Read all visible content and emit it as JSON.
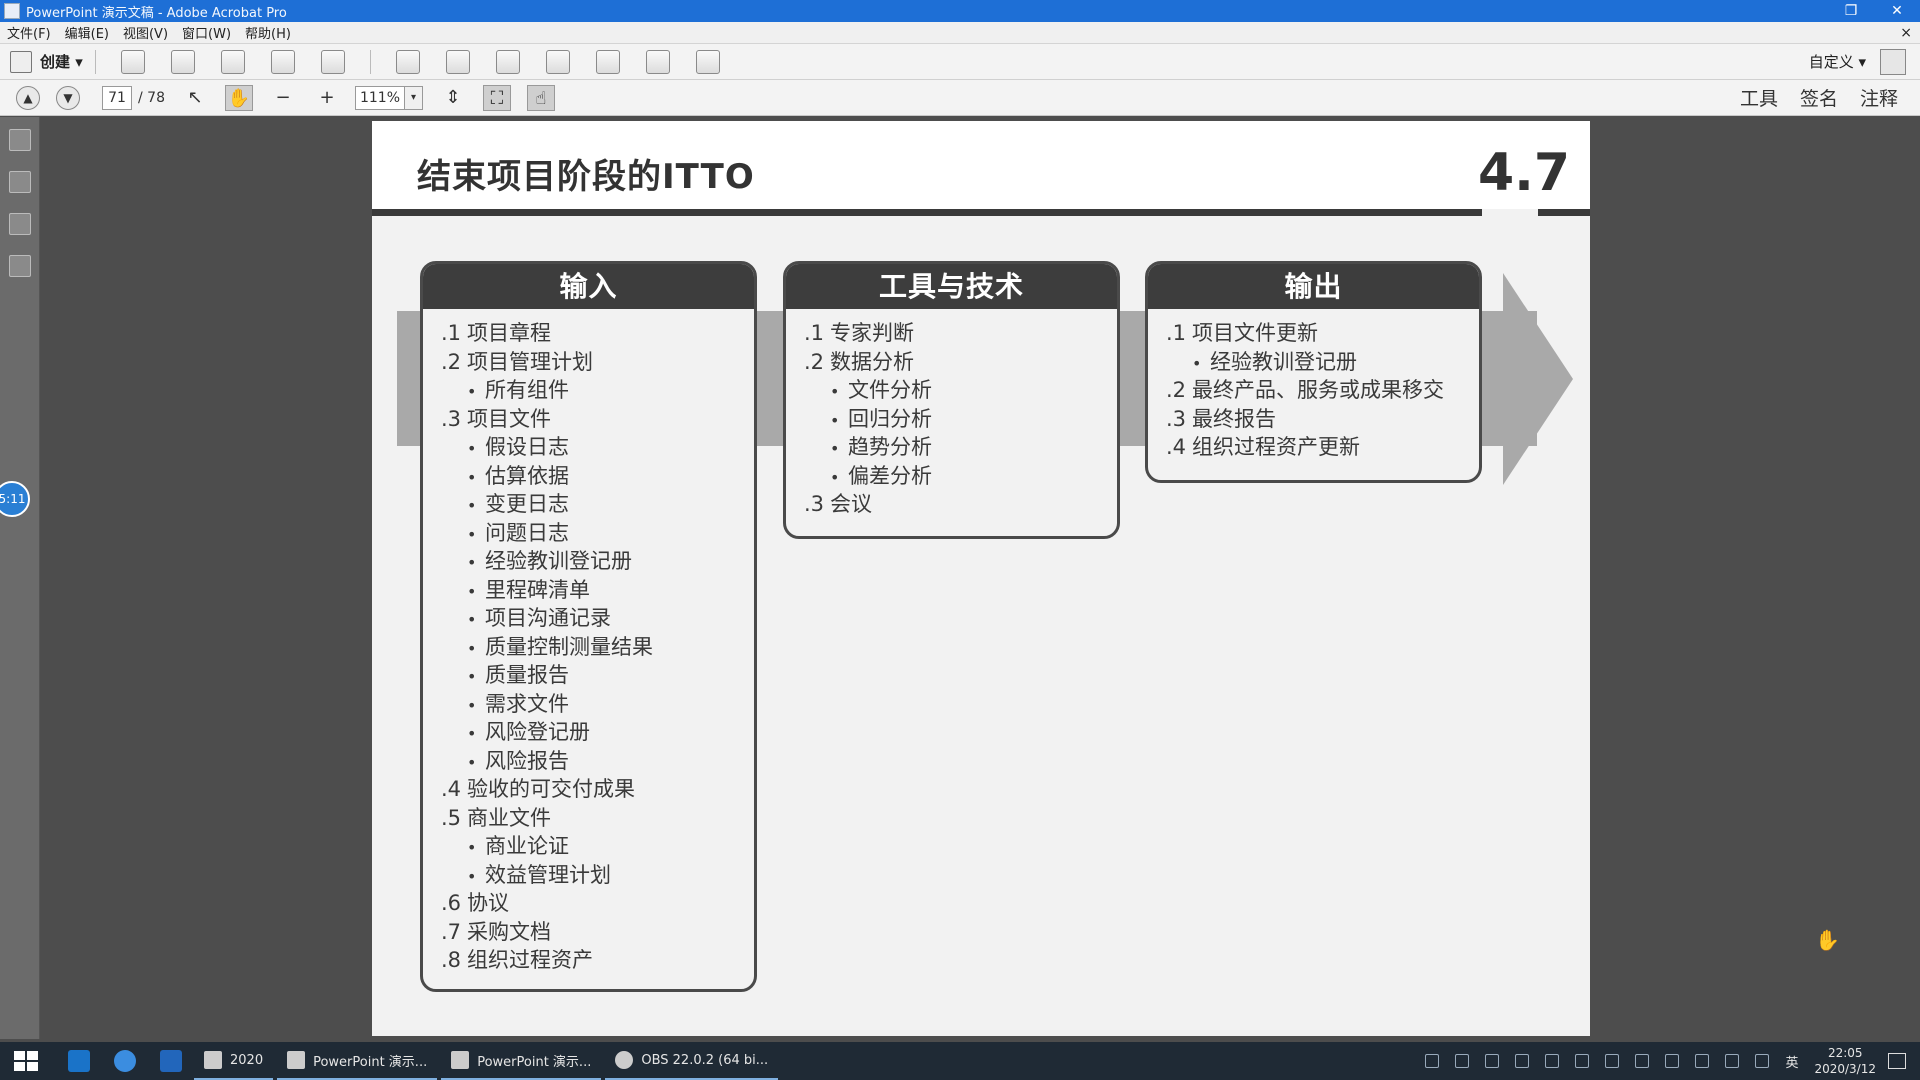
{
  "window": {
    "title": "PowerPoint 演示文稿 - Adobe Acrobat Pro",
    "restore_glyph": "❐",
    "close_glyph": "✕"
  },
  "menu": [
    "文件(F)",
    "编辑(E)",
    "视图(V)",
    "窗口(W)",
    "帮助(H)"
  ],
  "menu_close": "×",
  "toolbar": {
    "create_label": "创建 ▾",
    "customize_label": "自定义 ▾",
    "icons": [
      "open-icon",
      "save-icon",
      "print-icon",
      "edit-icon",
      "email-icon",
      "settings-icon",
      "comment-icon",
      "stamp-icon",
      "export-icon",
      "combine-icon",
      "protect-icon",
      "share-icon"
    ]
  },
  "nav": {
    "prev_glyph": "▲",
    "next_glyph": "▼",
    "current_page": "71",
    "total_pages": "/ 78",
    "select_glyph": "↖",
    "hand_glyph": "✋",
    "zoom_out_glyph": "−",
    "zoom_in_glyph": "+",
    "zoom": "111%",
    "zoom_drop_glyph": "▾",
    "fit_glyph": "⇕",
    "fullscreen_glyph": "⛶",
    "touch_glyph": "☝",
    "tools": "工具",
    "sign": "签名",
    "comment": "注释"
  },
  "timer": "5:11",
  "slide": {
    "title": "结束项目阶段的ITTO",
    "number": "4.7",
    "inputs": {
      "heading": "输入",
      "items": [
        {
          "n": ".1",
          "t": "项目章程"
        },
        {
          "n": ".2",
          "t": "项目管理计划"
        },
        {
          "sub": "所有组件"
        },
        {
          "n": ".3",
          "t": "项目文件"
        },
        {
          "sub": "假设日志"
        },
        {
          "sub": "估算依据"
        },
        {
          "sub": "变更日志"
        },
        {
          "sub": "问题日志"
        },
        {
          "sub": "经验教训登记册"
        },
        {
          "sub": "里程碑清单"
        },
        {
          "sub": "项目沟通记录"
        },
        {
          "sub": "质量控制测量结果"
        },
        {
          "sub": "质量报告"
        },
        {
          "sub": "需求文件"
        },
        {
          "sub": "风险登记册"
        },
        {
          "sub": "风险报告"
        },
        {
          "n": ".4",
          "t": "验收的可交付成果"
        },
        {
          "n": ".5",
          "t": "商业文件"
        },
        {
          "sub": "商业论证"
        },
        {
          "sub": "效益管理计划"
        },
        {
          "n": ".6",
          "t": "协议"
        },
        {
          "n": ".7",
          "t": "采购文档"
        },
        {
          "n": ".8",
          "t": "组织过程资产"
        }
      ]
    },
    "tools": {
      "heading": "工具与技术",
      "items": [
        {
          "n": ".1",
          "t": "专家判断"
        },
        {
          "n": ".2",
          "t": "数据分析"
        },
        {
          "sub": "文件分析"
        },
        {
          "sub": "回归分析"
        },
        {
          "sub": "趋势分析"
        },
        {
          "sub": "偏差分析"
        },
        {
          "n": ".3",
          "t": "会议"
        }
      ]
    },
    "outputs": {
      "heading": "输出",
      "items": [
        {
          "n": ".1",
          "t": "项目文件更新"
        },
        {
          "sub": "经验教训登记册"
        },
        {
          "n": ".2",
          "t": "最终产品、服务或成果移交"
        },
        {
          "n": ".3",
          "t": "最终报告"
        },
        {
          "n": ".4",
          "t": "组织过程资产更新"
        }
      ]
    },
    "bullet": "•"
  },
  "taskbar": {
    "folder_label": "2020",
    "tasks": [
      "PowerPoint 演示...",
      "PowerPoint 演示...",
      "OBS 22.0.2 (64 bi..."
    ],
    "ime": "英",
    "time": "22:05",
    "date": "2020/3/12"
  },
  "colors": {
    "titlebar": "#1e6fd6",
    "panel_header": "#3d3d3d",
    "arrow": "#a9a9a9"
  }
}
